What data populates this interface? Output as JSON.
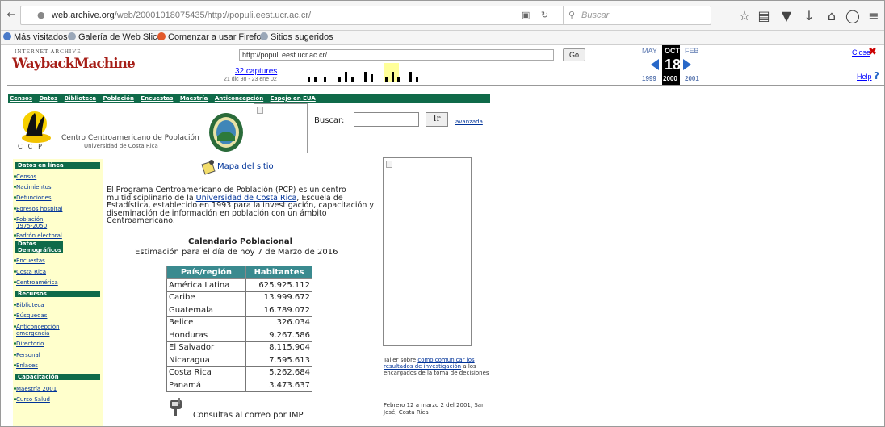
{
  "browser": {
    "url_prefix": "web.archive.org",
    "url_rest": "/web/20001018075435/http://populi.eest.ucr.ac.cr/",
    "search_placeholder": "Buscar"
  },
  "bookmarks": [
    {
      "label": "Más visitados",
      "color": "#4a7ac9"
    },
    {
      "label": "Galería de Web Slice",
      "color": "#9aa7b8"
    },
    {
      "label": "Comenzar a usar Firefox",
      "color": "#e2582a"
    },
    {
      "label": "Sitios sugeridos",
      "color": "#9aa7b8"
    }
  ],
  "wayback": {
    "logo_top": "INTERNET ARCHIVE",
    "logo_main": "WaybackMachine",
    "url": "http://populi.eest.ucr.ac.cr/",
    "go": "Go",
    "captures": "32 captures",
    "range": "21 dic 98 - 23 ene 02",
    "month_prev": "MAY",
    "month_cur": "OCT",
    "month_next": "FEB",
    "day": "18",
    "year_prev": "1999",
    "year_cur": "2000",
    "year_next": "2001",
    "close": "Close",
    "help": "Help"
  },
  "page": {
    "menu": [
      "Censos",
      "Datos",
      "Biblioteca",
      "Población",
      "Encuestas",
      "Maestría",
      "Anticoncepción",
      "Espejo en EUA"
    ],
    "logo_letters": "CCP",
    "org_name": "Centro Centroamericano de Población",
    "org_sub": "Universidad de Costa Rica",
    "search_label": "Buscar:",
    "search_button": "Ir",
    "search_advanced": "avanzada",
    "mapa": "Mapa del sitio",
    "intro_before": "El Programa Centroamericano de Población (PCP) es un centro multidisciplinario de la ",
    "intro_link": "Universidad de Costa Rica",
    "intro_after": ", Escuela de Estadística, establecido en 1993 para la investigación, capacitación y diseminación de información en población con un ámbito Centroamericano.",
    "cal_title": "Calendario Poblacional",
    "cal_sub": "Estimación para el día de hoy 7 de Marzo de 2016",
    "table": {
      "headers": [
        "País/región",
        "Habitantes"
      ],
      "rows": [
        [
          "América Latina",
          "625.925.112"
        ],
        [
          "Caribe",
          "13.999.672"
        ],
        [
          "Guatemala",
          "16.789.072"
        ],
        [
          "Belice",
          "326.034"
        ],
        [
          "Honduras",
          "9.267.586"
        ],
        [
          "El Salvador",
          "8.115.904"
        ],
        [
          "Nicaragua",
          "7.595.613"
        ],
        [
          "Costa Rica",
          "5.262.684"
        ],
        [
          "Panamá",
          "3.473.637"
        ]
      ]
    },
    "mail": "Consultas al correo por IMP",
    "taller_before": "Taller sobre ",
    "taller_link": "como comunicar los resultados de investigación",
    "taller_after": " a los encargados de la toma de decisiones",
    "fecha": "Febrero 12 a marzo 2 del 2001, San José, Costa Rica"
  },
  "nav": {
    "head_datos": "Datos en línea",
    "datos": [
      "Censos",
      "Nacimientos",
      "Defunciones",
      "Egresos hospital",
      "Población 1975-2050",
      "Padrón electoral"
    ],
    "head_demo": "Datos Demográficos",
    "demo": [
      "Encuestas",
      "Costa Rica",
      "Centroamérica"
    ],
    "head_rec": "Recursos",
    "rec": [
      "Biblioteca",
      "Búsquedas",
      "Anticoncepción emergencia",
      "Directorio",
      "Personal",
      "Enlaces"
    ],
    "head_cap": "Capacitación",
    "cap": [
      "Maestría 2001",
      "Curso Salud"
    ]
  }
}
